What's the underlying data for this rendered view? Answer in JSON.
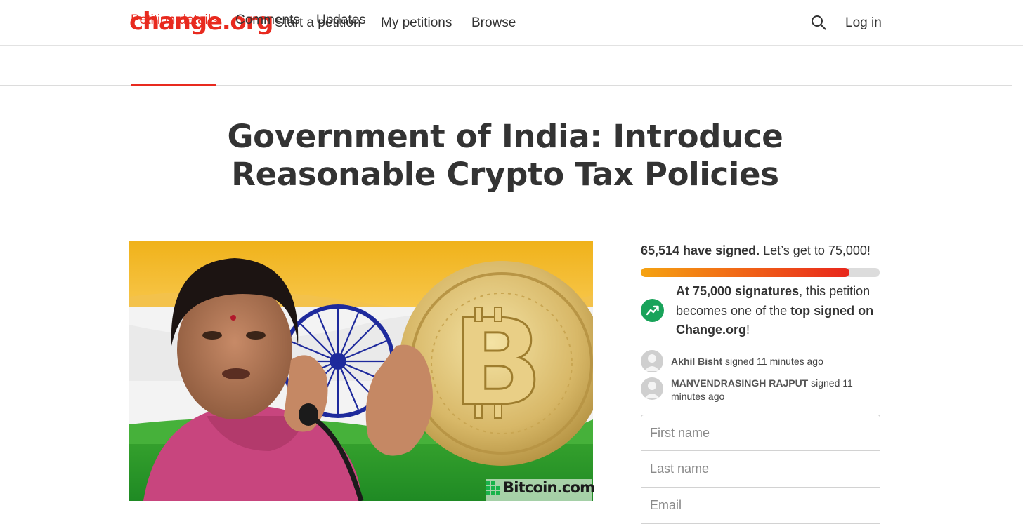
{
  "header": {
    "logo": "change.org",
    "nav": [
      "Start a petition",
      "My petitions",
      "Browse"
    ],
    "login_label": "Log in",
    "search_icon": "search-icon"
  },
  "tabs": [
    {
      "label": "Petition details",
      "active": true
    },
    {
      "label": "Comments",
      "active": false
    },
    {
      "label": "Updates",
      "active": false
    }
  ],
  "petition": {
    "title": "Government of India: Introduce Reasonable Crypto Tax Policies",
    "image_watermark": "Bitcoin.com"
  },
  "signatures": {
    "count_text": "65,514 have signed.",
    "goal_text": "Let’s get to 75,000!",
    "count": 65514,
    "goal": 75000,
    "progress_fraction": 0.8735
  },
  "milestone": {
    "icon": "trending-up-icon",
    "bold1": "At 75,000 signatures",
    "text1": ", this petition becomes one of the ",
    "bold2": "top signed on Change.org",
    "text2": "!"
  },
  "recent_signers": [
    {
      "name": "Akhil Bisht",
      "action": "signed 11 minutes ago"
    },
    {
      "name": "MANVENDRASINGH RAJPUT",
      "action": "signed 11 minutes ago"
    }
  ],
  "form": {
    "first_name_placeholder": "First name",
    "last_name_placeholder": "Last name",
    "email_placeholder": "Email"
  },
  "colors": {
    "brand_red": "#e82a1f",
    "progress_start": "#f5a312",
    "progress_end": "#e8261c",
    "milestone_green": "#19a35a"
  }
}
